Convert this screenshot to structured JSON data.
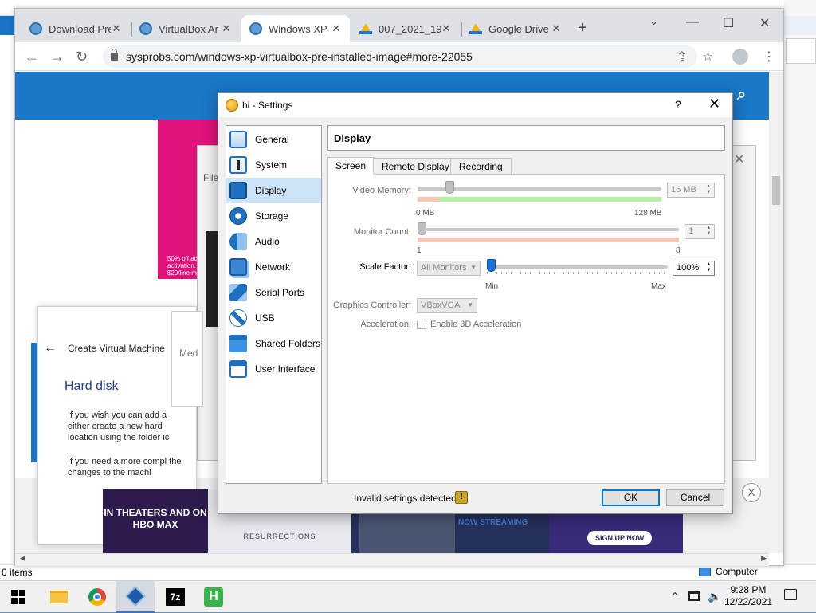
{
  "explorer": {
    "status_left": "0 items",
    "status_right": "Computer"
  },
  "browser": {
    "tabs": [
      {
        "label": "Download Pre",
        "icon": "globe-icon",
        "active": false
      },
      {
        "label": "VirtualBox Ar",
        "icon": "globe-icon",
        "active": false
      },
      {
        "label": "Windows XP",
        "icon": "globe-icon",
        "active": true
      },
      {
        "label": "007_2021_19",
        "icon": "google-drive-icon",
        "active": false
      },
      {
        "label": "Google Drive",
        "icon": "google-drive-icon",
        "active": false
      }
    ],
    "new_tab_glyph": "+",
    "url": "sysprobs.com/windows-xp-virtualbox-pre-installed-image#more-22055"
  },
  "page": {
    "ad_pink_text": "50% off ad activation. $20/line mo",
    "grey_window_menu": "File",
    "create_vm": {
      "title": "Create Virtual Machine",
      "heading": "Hard disk",
      "paragraph1": "If you wish you can add a either create a new hard location using the folder ic",
      "paragraph2": "If you need a more compl the changes to the machi"
    },
    "small_window_text": "Med",
    "ad": {
      "left_text": "IN THEATERS AND ON HBO MAX",
      "mid_text": "RESURRECTIONS",
      "right_text": "NOW STREAMING",
      "signup": "SIGN UP NOW",
      "close": "X"
    }
  },
  "dialog": {
    "title": "hi - Settings",
    "help": "?",
    "close": "✕",
    "nav": [
      {
        "label": "General",
        "icon": "general-icon",
        "selected": false
      },
      {
        "label": "System",
        "icon": "system-icon",
        "selected": false
      },
      {
        "label": "Display",
        "icon": "display-icon",
        "selected": true
      },
      {
        "label": "Storage",
        "icon": "storage-icon",
        "selected": false
      },
      {
        "label": "Audio",
        "icon": "audio-icon",
        "selected": false
      },
      {
        "label": "Network",
        "icon": "network-icon",
        "selected": false
      },
      {
        "label": "Serial Ports",
        "icon": "serial-ports-icon",
        "selected": false
      },
      {
        "label": "USB",
        "icon": "usb-icon",
        "selected": false
      },
      {
        "label": "Shared Folders",
        "icon": "shared-folders-icon",
        "selected": false
      },
      {
        "label": "User Interface",
        "icon": "user-interface-icon",
        "selected": false
      }
    ],
    "panel_title": "Display",
    "tabs": [
      "Screen",
      "Remote Display",
      "Recording"
    ],
    "active_tab": "Screen",
    "screen": {
      "video_memory": {
        "label": "Video Memory:",
        "value": "16 MB",
        "min_label": "0 MB",
        "max_label": "128 MB",
        "fraction": 0.12,
        "enabled": false
      },
      "monitor_count": {
        "label": "Monitor Count:",
        "value": "1",
        "min_label": "1",
        "max_label": "8",
        "fraction": 0.0,
        "enabled": false
      },
      "scale_factor": {
        "label": "Scale Factor:",
        "combo": "All Monitors",
        "value": "100%",
        "min_label": "Min",
        "max_label": "Max",
        "fraction": 0.0,
        "enabled": true
      },
      "graphics_controller": {
        "label": "Graphics Controller:",
        "value": "VBoxVGA"
      },
      "acceleration": {
        "label": "Acceleration:",
        "checkbox_label": "Enable 3D Acceleration",
        "checked": false
      }
    },
    "footer": {
      "message": "Invalid settings detected",
      "ok": "OK",
      "cancel": "Cancel"
    }
  },
  "taskbar": {
    "apps": [
      "file-explorer",
      "chrome",
      "virtualbox",
      "7-zip",
      "h-app"
    ],
    "app_7z_label": "7z",
    "app_h_label": "H",
    "time": "9:28 PM",
    "date": "12/22/2021"
  }
}
